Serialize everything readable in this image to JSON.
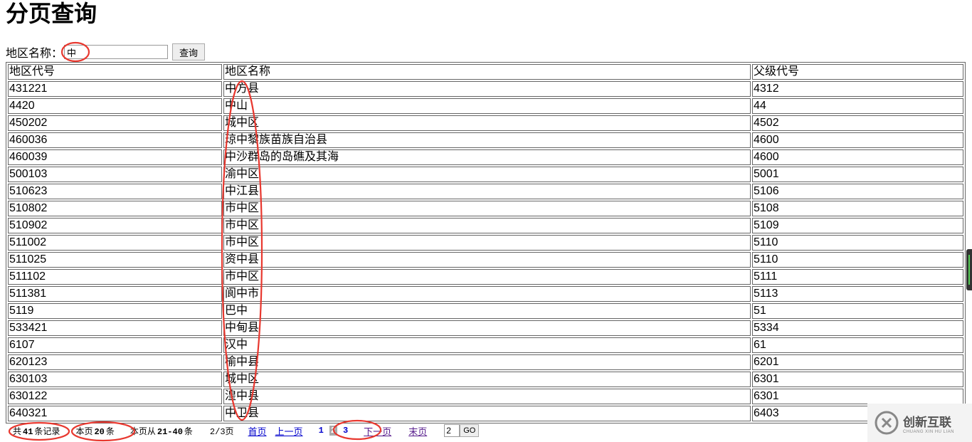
{
  "page": {
    "title": "分页查询"
  },
  "search": {
    "label": "地区名称：",
    "value": "中",
    "button_label": "查询"
  },
  "table": {
    "headers": [
      "地区代号",
      "地区名称",
      "父级代号"
    ],
    "rows": [
      [
        "431221",
        "中方县",
        "4312"
      ],
      [
        "4420",
        "中山",
        "44"
      ],
      [
        "450202",
        "城中区",
        "4502"
      ],
      [
        "460036",
        "琼中黎族苗族自治县",
        "4600"
      ],
      [
        "460039",
        "中沙群岛的岛礁及其海",
        "4600"
      ],
      [
        "500103",
        "渝中区",
        "5001"
      ],
      [
        "510623",
        "中江县",
        "5106"
      ],
      [
        "510802",
        "市中区",
        "5108"
      ],
      [
        "510902",
        "市中区",
        "5109"
      ],
      [
        "511002",
        "市中区",
        "5110"
      ],
      [
        "511025",
        "资中县",
        "5110"
      ],
      [
        "511102",
        "市中区",
        "5111"
      ],
      [
        "511381",
        "阆中市",
        "5113"
      ],
      [
        "5119",
        "巴中",
        "51"
      ],
      [
        "533421",
        "中甸县",
        "5334"
      ],
      [
        "6107",
        "汉中",
        "61"
      ],
      [
        "620123",
        "榆中县",
        "6201"
      ],
      [
        "630103",
        "城中区",
        "6301"
      ],
      [
        "630122",
        "湟中县",
        "6301"
      ],
      [
        "640321",
        "中卫县",
        "6403"
      ]
    ]
  },
  "pager": {
    "total_prefix": "共",
    "total": "41",
    "total_suffix": "条记录",
    "page_size_prefix": "本页",
    "page_size": "20",
    "page_size_suffix": "条",
    "range_prefix": "本页从",
    "range": "21-40",
    "range_suffix": "条",
    "page_fraction": "2/3页",
    "first_label": "首页",
    "prev_label": "上一页",
    "page_numbers": [
      "1",
      "2",
      "3"
    ],
    "current_page": "2",
    "next_label": "下一页",
    "last_label": "末页",
    "go_value": "2",
    "go_label": "GO"
  },
  "watermark": {
    "text_cn": "创新互联",
    "text_en": "CHUANG XIN HU LIAN"
  },
  "colors": {
    "annotation": "#e8382f",
    "link": "#0000cc",
    "visited_link": "#551a8b"
  }
}
